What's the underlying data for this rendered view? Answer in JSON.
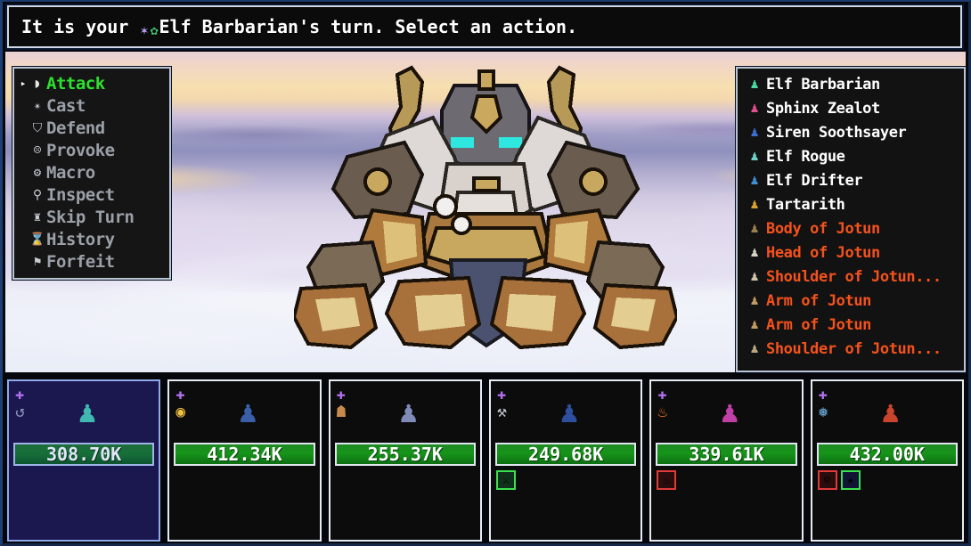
{
  "banner": {
    "prefix": "It is your ",
    "icon_sparkle": "sparkle-icon",
    "icon_leaf": "leaf-icon",
    "actor": "Elf Barbarian",
    "suffix": "'s turn. Select an action."
  },
  "action_menu": {
    "caret": "▸",
    "items": [
      {
        "label": "Attack",
        "icon": "sword-shield-icon",
        "glyph": "◗",
        "selected": true
      },
      {
        "label": "Cast",
        "icon": "sparkles-icon",
        "glyph": "✴",
        "selected": false
      },
      {
        "label": "Defend",
        "icon": "shield-icon",
        "glyph": "⛉",
        "selected": false
      },
      {
        "label": "Provoke",
        "icon": "taunt-face-icon",
        "glyph": "☹",
        "selected": false
      },
      {
        "label": "Macro",
        "icon": "gear-icon",
        "glyph": "⚙",
        "selected": false
      },
      {
        "label": "Inspect",
        "icon": "magnifier-icon",
        "glyph": "⚲",
        "selected": false
      },
      {
        "label": "Skip Turn",
        "icon": "hourglass-skip-icon",
        "glyph": "♜",
        "selected": false
      },
      {
        "label": "History",
        "icon": "hourglass-icon",
        "glyph": "⌛",
        "selected": false
      },
      {
        "label": "Forfeit",
        "icon": "flag-icon",
        "glyph": "⚑",
        "selected": false
      }
    ]
  },
  "turn_order": {
    "entries": [
      {
        "name": "Elf Barbarian",
        "side": "ally",
        "icon": "elf-barbarian-portrait",
        "glyph": "♟",
        "color": "#4ad9a0"
      },
      {
        "name": "Sphinx Zealot",
        "side": "ally",
        "icon": "sphinx-zealot-portrait",
        "glyph": "♟",
        "color": "#e0508c"
      },
      {
        "name": "Siren Soothsayer",
        "side": "ally",
        "icon": "siren-soothsayer-portrait",
        "glyph": "♟",
        "color": "#3d6fd0"
      },
      {
        "name": "Elf Rogue",
        "side": "ally",
        "icon": "elf-rogue-portrait",
        "glyph": "♟",
        "color": "#6fd0c8"
      },
      {
        "name": "Elf Drifter",
        "side": "ally",
        "icon": "elf-drifter-portrait",
        "glyph": "♟",
        "color": "#3f8fd0"
      },
      {
        "name": "Tartarith",
        "side": "ally",
        "icon": "tartarith-portrait",
        "glyph": "♟",
        "color": "#d8a030"
      },
      {
        "name": "Body of Jotun",
        "side": "enemy",
        "icon": "jotun-body-portrait",
        "glyph": "♟",
        "color": "#9a7e52"
      },
      {
        "name": "Head of Jotun",
        "side": "enemy",
        "icon": "jotun-head-portrait",
        "glyph": "♟",
        "color": "#d8d2c4"
      },
      {
        "name": "Shoulder of Jotun...",
        "side": "enemy",
        "icon": "jotun-shoulder-portrait",
        "glyph": "♟",
        "color": "#cfc3a8"
      },
      {
        "name": "Arm of Jotun",
        "side": "enemy",
        "icon": "jotun-arm-portrait",
        "glyph": "♟",
        "color": "#c09a60"
      },
      {
        "name": "Arm of Jotun",
        "side": "enemy",
        "icon": "jotun-arm-portrait",
        "glyph": "♟",
        "color": "#c09a60"
      },
      {
        "name": "Shoulder of Jotun...",
        "side": "enemy",
        "icon": "jotun-shoulder-portrait",
        "glyph": "♟",
        "color": "#b8a67e"
      }
    ]
  },
  "party": {
    "members": [
      {
        "hp": "308.70K",
        "active": true,
        "sprite": "elf-barbarian-sprite",
        "sprite_glyph": "♟",
        "sprite_color": "#3fb8b0",
        "badges": [
          "buff-cross-icon",
          "reload-icon"
        ],
        "badge_glyphs": [
          "✚",
          "↺"
        ],
        "badge_colors": [
          "#b36ff0",
          "#8a93b8"
        ],
        "statuses": []
      },
      {
        "hp": "412.34K",
        "active": false,
        "sprite": "elf-drifter-sprite",
        "sprite_glyph": "♟",
        "sprite_color": "#3a5fa8",
        "badges": [
          "buff-cross-icon",
          "prism-shell-icon"
        ],
        "badge_glyphs": [
          "✚",
          "◉"
        ],
        "badge_colors": [
          "#b36ff0",
          "#f0c040"
        ],
        "statuses": []
      },
      {
        "hp": "255.37K",
        "active": false,
        "sprite": "elf-rogue-sprite",
        "sprite_glyph": "♟",
        "sprite_color": "#7f8ab8",
        "badges": [
          "buff-cross-icon",
          "potion-keg-icon"
        ],
        "badge_glyphs": [
          "✚",
          "☗"
        ],
        "badge_colors": [
          "#b36ff0",
          "#c98a50"
        ],
        "statuses": []
      },
      {
        "hp": "249.68K",
        "active": false,
        "sprite": "siren-soothsayer-sprite",
        "sprite_glyph": "♟",
        "sprite_color": "#2e4e9e",
        "badges": [
          "buff-cross-icon",
          "warhammer-icon"
        ],
        "badge_glyphs": [
          "✚",
          "⚒"
        ],
        "badge_colors": [
          "#b36ff0",
          "#c8ccd4"
        ],
        "statuses": [
          {
            "icon": "sword-buff-status",
            "glyph": "⚔",
            "style": "chip-green"
          }
        ]
      },
      {
        "hp": "339.61K",
        "active": false,
        "sprite": "sphinx-zealot-sprite",
        "sprite_glyph": "♟",
        "sprite_color": "#c040a8",
        "badges": [
          "buff-cross-icon",
          "flame-icon"
        ],
        "badge_glyphs": [
          "✚",
          "♨"
        ],
        "badge_colors": [
          "#b36ff0",
          "#ff7a20"
        ],
        "statuses": [
          {
            "icon": "burn-status",
            "glyph": "♨",
            "style": "chip-red"
          }
        ]
      },
      {
        "hp": "432.00K",
        "active": false,
        "sprite": "tartarith-sprite",
        "sprite_glyph": "♟",
        "sprite_color": "#c8442c",
        "badges": [
          "buff-cross-icon",
          "frost-burst-icon"
        ],
        "badge_glyphs": [
          "✚",
          "❅"
        ],
        "badge_colors": [
          "#b36ff0",
          "#74b8e8"
        ],
        "statuses": [
          {
            "icon": "rage-status",
            "glyph": "☺",
            "style": "chip-red"
          },
          {
            "icon": "star-status",
            "glyph": "★",
            "style": "chip-blue"
          }
        ]
      }
    ]
  },
  "battlefield": {
    "boss": "jotun-giant-sprite",
    "boss_glyph": "⛰"
  }
}
